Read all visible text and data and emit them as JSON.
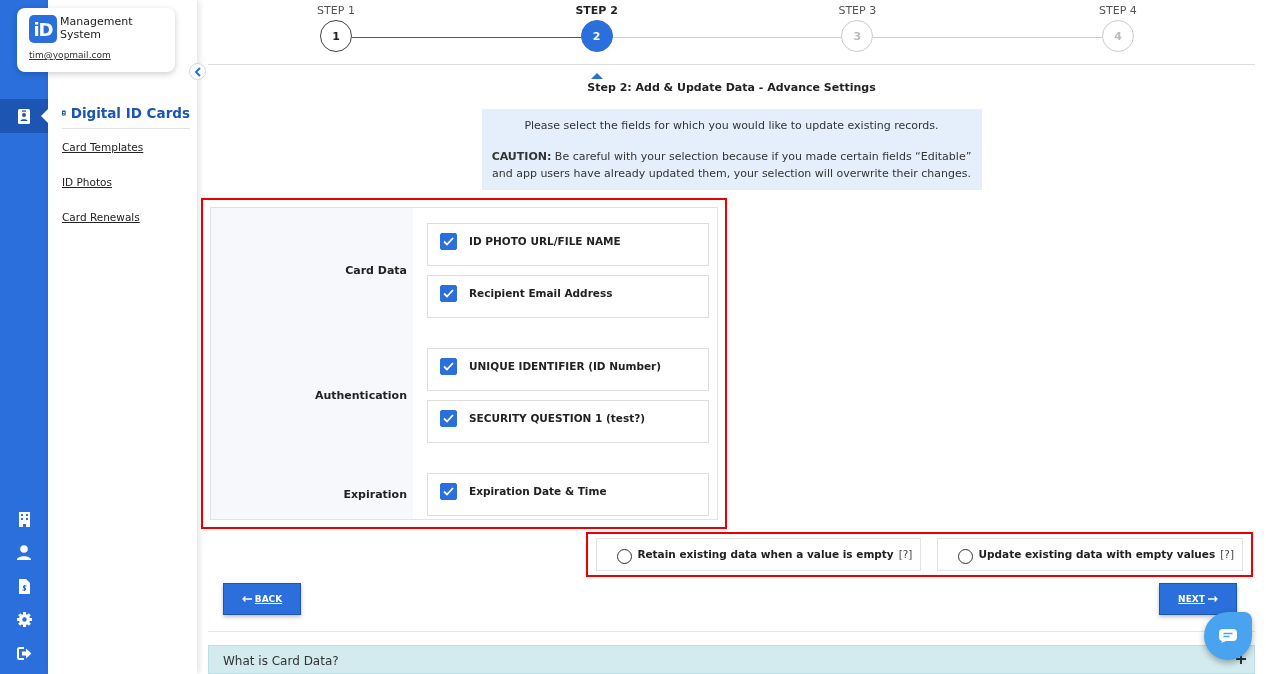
{
  "brand": {
    "logo": "iD",
    "name": "Management System",
    "email": "tim@yopmail.com"
  },
  "rail": [
    {
      "kind": "id-card",
      "selected": true
    },
    {
      "kind": "building",
      "selected": false
    },
    {
      "kind": "person",
      "selected": false
    },
    {
      "kind": "invoice",
      "selected": false
    },
    {
      "kind": "settings",
      "selected": false
    },
    {
      "kind": "logout",
      "selected": false
    }
  ],
  "sidebar": {
    "title": "Digital ID Cards",
    "items": [
      "Card Templates",
      "ID Photos",
      "Card Renewals"
    ]
  },
  "steps": [
    {
      "label": "STEP 1",
      "number": "1",
      "selected": false,
      "completed": true
    },
    {
      "label": "STEP 2",
      "number": "2",
      "selected": true,
      "completed": false
    },
    {
      "label": "STEP 3",
      "number": "3",
      "selected": false,
      "completed": false
    },
    {
      "label": "STEP 4",
      "number": "4",
      "selected": false,
      "completed": false
    }
  ],
  "heading": "Step 2: Add & Update Data - Advance Settings",
  "notice": [
    "Please select the fields for which you would like to update existing records.",
    "**CAUTION:** Be careful with your selection because if you made certain fields “Editable” and app users have already updated them, your selection will overwrite their changes."
  ],
  "field_groups": {
    "highlighted": true,
    "groups": [
      {
        "label": "Card Data",
        "fields": [
          {
            "label": "ID PHOTO URL/FILE NAME",
            "checked": true
          },
          {
            "label": "Recipient Email Address",
            "checked": true
          }
        ]
      },
      {
        "label": "Authentication",
        "fields": [
          {
            "label": "UNIQUE IDENTIFIER (ID Number)",
            "checked": true
          },
          {
            "label": "SECURITY QUESTION 1 (test?)",
            "checked": true
          }
        ]
      },
      {
        "label": "Expiration",
        "fields": [
          {
            "label": "Expiration Date & Time",
            "checked": true
          }
        ]
      }
    ]
  },
  "empty_value_options": {
    "highlighted": true,
    "options": [
      {
        "label": "Retain existing data when a value is empty",
        "help": "[?]",
        "selected": false
      },
      {
        "label": "Update existing data with empty values",
        "help": "[?]",
        "selected": false
      }
    ]
  },
  "buttons": {
    "back": "BACK",
    "next": "NEXT"
  },
  "accordion": {
    "title": "What is Card Data?",
    "expanded": false
  }
}
